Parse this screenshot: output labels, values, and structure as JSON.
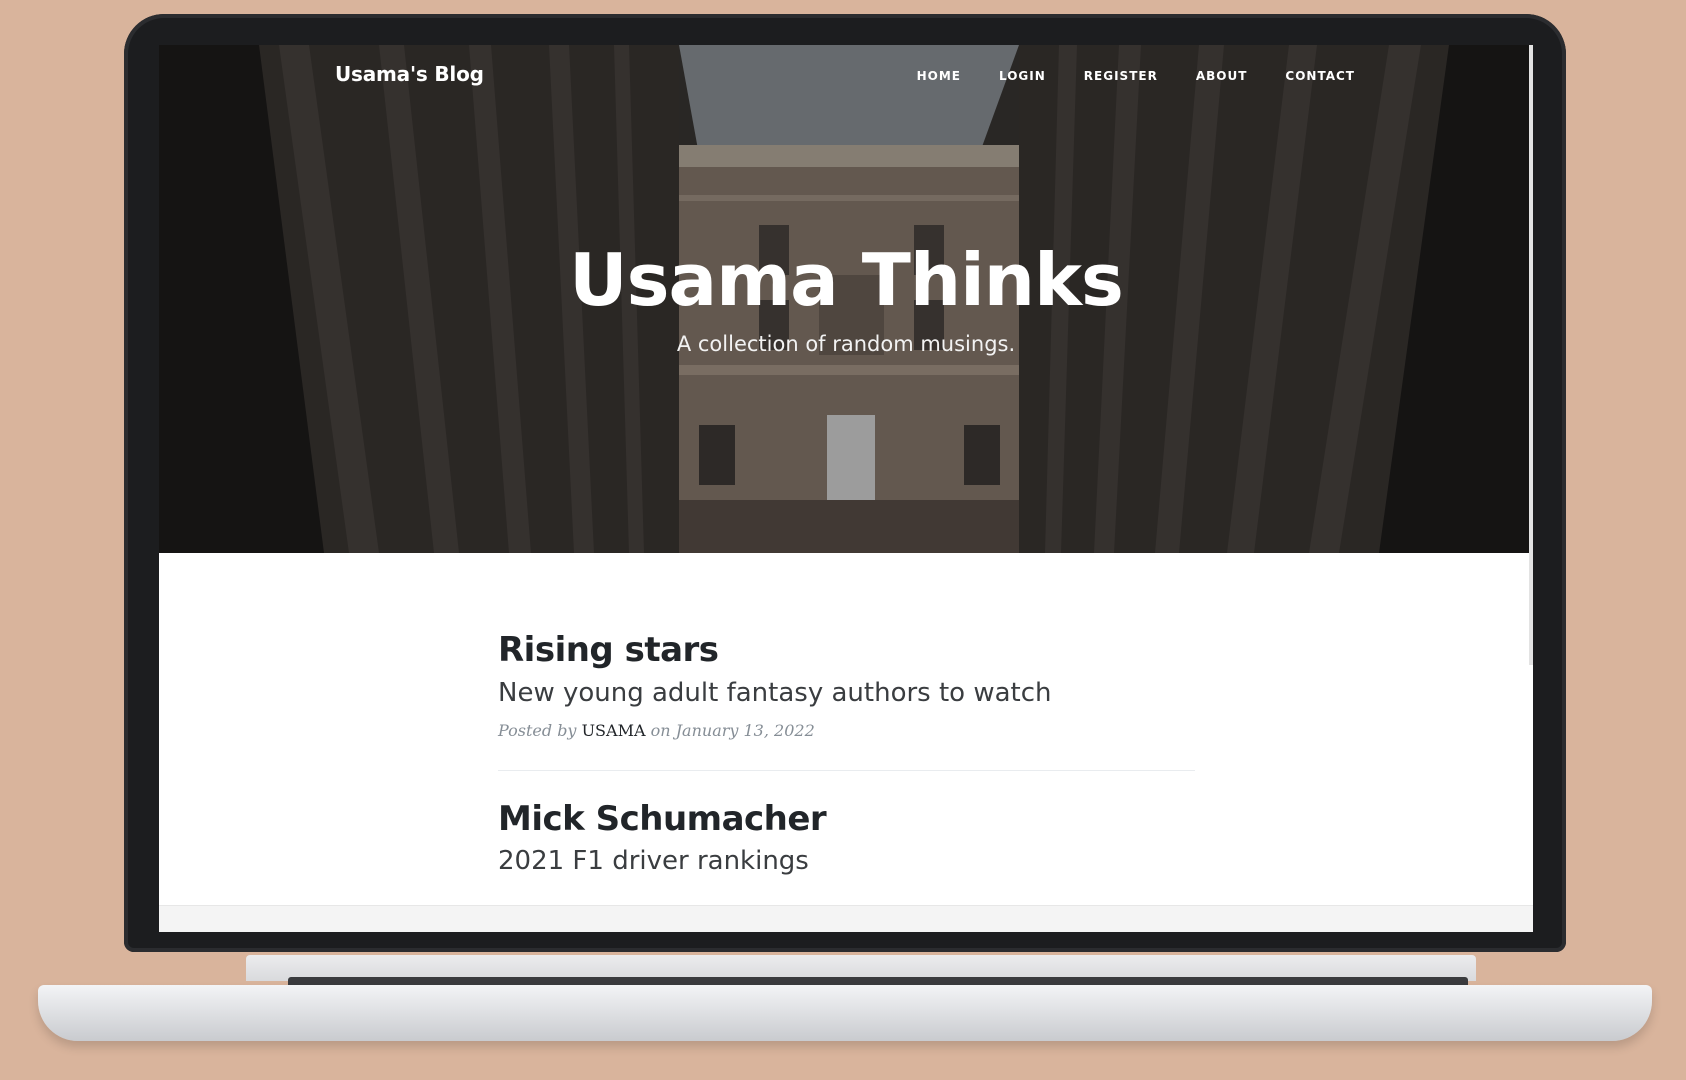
{
  "site": {
    "brand": "Usama's Blog",
    "nav": [
      "HOME",
      "LOGIN",
      "REGISTER",
      "ABOUT",
      "CONTACT"
    ]
  },
  "hero": {
    "title": "Usama Thinks",
    "subtitle": "A collection of random musings."
  },
  "posts": [
    {
      "title": "Rising stars",
      "subtitle": "New young adult fantasy authors to watch",
      "meta_prefix": "Posted by",
      "author": "USAMA",
      "meta_on": "on",
      "date": "January 13, 2022"
    },
    {
      "title": "Mick Schumacher",
      "subtitle": "2021 F1 driver rankings"
    }
  ],
  "colors": {
    "background": "#d9b49c",
    "text_dark": "#212529",
    "meta_grey": "#868e96"
  }
}
